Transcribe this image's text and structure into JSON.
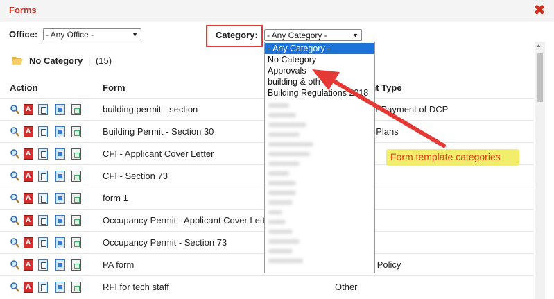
{
  "window": {
    "title": "Forms"
  },
  "filters": {
    "office_label": "Office:",
    "office_value": "- Any Office -",
    "category_label": "Category:",
    "category_value": "- Any Category -"
  },
  "dropdown": {
    "options": [
      "- Any Category -",
      "No Category",
      "Approvals",
      "building & oth",
      "Building Regulations 2018"
    ],
    "selected_index": 0
  },
  "category_heading": {
    "name": "No Category",
    "count": "(15)"
  },
  "table": {
    "headers": {
      "action": "Action",
      "form": "Form",
      "doc_type": "Document Type"
    },
    "rows": [
      {
        "form": "building permit - section",
        "doc_type": "Receipt for Payment of DCP"
      },
      {
        "form": "Building Permit - Section 30",
        "doc_type": "Structural Plans"
      },
      {
        "form": "CFI - Applicant Cover Letter",
        "doc_type": ""
      },
      {
        "form": "CFI - Section 73",
        "doc_type": ""
      },
      {
        "form": "form 1",
        "doc_type": ""
      },
      {
        "form": "Occupancy Permit - Applicant Cover Letter",
        "doc_type": ""
      },
      {
        "form": "Occupancy Permit - Section 73",
        "doc_type": ""
      },
      {
        "form": "PA form",
        "doc_type": "Insurance Policy"
      },
      {
        "form": "RFI for tech staff",
        "doc_type": "Other"
      }
    ]
  },
  "annotation": {
    "text": "Form template categories"
  },
  "colors": {
    "title": "#c0392b",
    "highlight_box": "#e53935",
    "selected_option": "#1e73d8",
    "callout_bg": "#f2ee6b",
    "callout_text": "#d84315"
  }
}
